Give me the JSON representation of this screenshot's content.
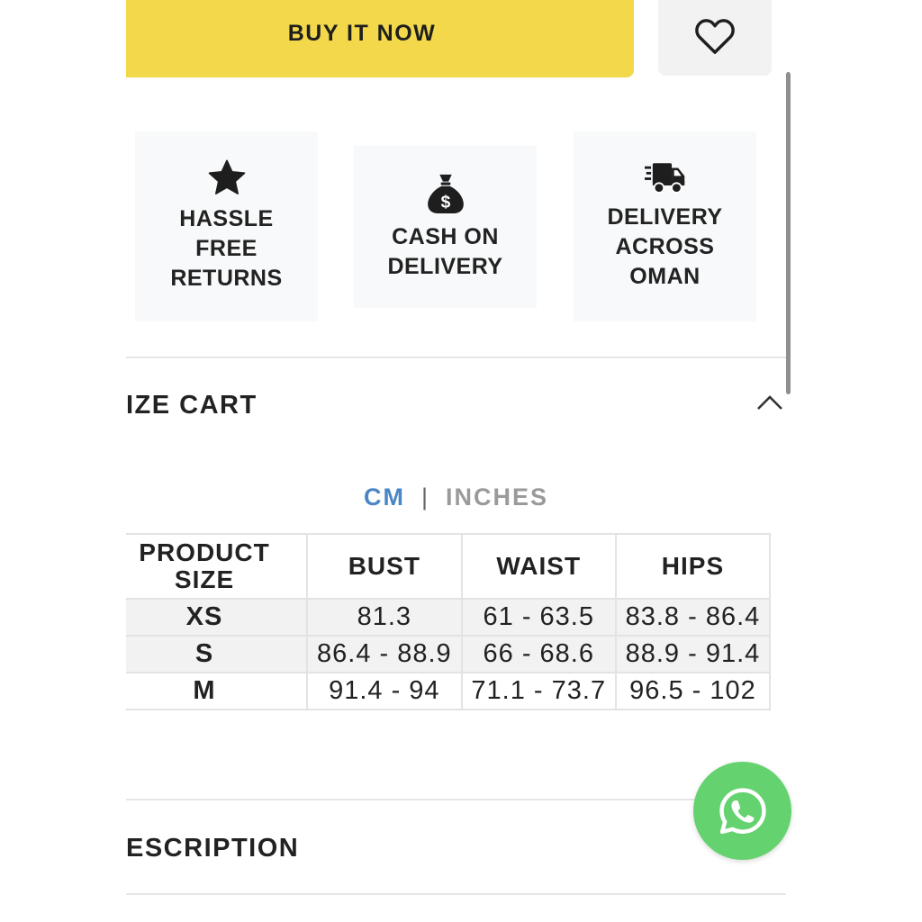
{
  "actions": {
    "buy_now_label": "BUY IT NOW",
    "buy_color": "#f2d84a"
  },
  "features": [
    {
      "icon": "star-icon",
      "label": "HASSLE\nFREE\nRETURNS"
    },
    {
      "icon": "money-bag-icon",
      "label": "CASH ON\nDELIVERY"
    },
    {
      "icon": "delivery-truck-icon",
      "label": "DELIVERY\nACROSS\nOMAN"
    }
  ],
  "size_chart": {
    "title": "IZE CART",
    "units": {
      "active": "CM",
      "separator": "|",
      "inactive": "INCHES"
    },
    "headers": [
      "PRODUCT\nSIZE",
      "BUST",
      "WAIST",
      "HIPS"
    ],
    "rows": [
      [
        "XS",
        "81.3",
        "61 - 63.5",
        "83.8 - 86.4"
      ],
      [
        "S",
        "86.4 - 88.9",
        "66 - 68.6",
        "88.9 - 91.4"
      ],
      [
        "M",
        "91.4 - 94",
        "71.1 - 73.7",
        "96.5 - 102"
      ]
    ]
  },
  "description": {
    "title": "ESCRIPTION"
  },
  "colors": {
    "accent_blue": "#4a86c5",
    "whatsapp_green": "#64d36f"
  }
}
